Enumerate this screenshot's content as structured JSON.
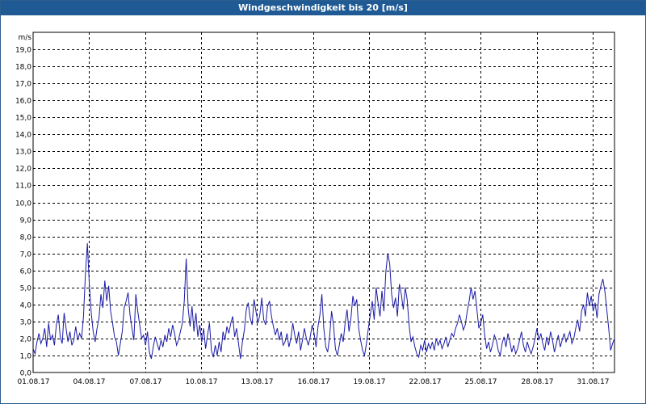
{
  "window": {
    "title": "Windgeschwindigkeit bis 20 [m/s]"
  },
  "colors": {
    "titlebar": "#1f5a94",
    "series": "#1a1aa6",
    "grid": "#000000"
  },
  "chart_data": {
    "type": "line",
    "title": "Windgeschwindigkeit bis 20 [m/s]",
    "ylabel": "m/s",
    "xlabel": "",
    "ylim": [
      0,
      20
    ],
    "ytick_step": 1,
    "grid": true,
    "xtick_labels": [
      "01.08.17",
      "04.08.17",
      "07.08.17",
      "10.08.17",
      "13.08.17",
      "16.08.17",
      "19.08.17",
      "22.08.17",
      "25.08.17",
      "28.08.17",
      "31.08.17"
    ],
    "series": [
      {
        "values": [
          1.4,
          1.1,
          1.8,
          2.3,
          1.7,
          2.0,
          2.6,
          1.5,
          2.9,
          1.9,
          2.2,
          1.6,
          2.8,
          3.4,
          2.1,
          1.7,
          3.5,
          2.6,
          1.8,
          2.4,
          1.6,
          1.9,
          2.7,
          1.9,
          2.3,
          2.0,
          3.3,
          5.8,
          7.6,
          5.2,
          3.5,
          2.4,
          1.8,
          2.6,
          3.2,
          4.6,
          3.8,
          5.4,
          4.2,
          5.1,
          3.6,
          2.9,
          2.1,
          1.8,
          1.0,
          1.7,
          2.4,
          3.8,
          4.2,
          4.7,
          3.4,
          2.6,
          1.9,
          4.6,
          3.6,
          2.8,
          2.0,
          2.2,
          1.6,
          2.4,
          1.2,
          0.8,
          1.5,
          2.1,
          1.7,
          1.3,
          1.9,
          1.5,
          2.2,
          1.8,
          2.6,
          2.1,
          2.8,
          2.3,
          1.6,
          1.9,
          2.4,
          2.9,
          4.2,
          6.7,
          3.8,
          2.7,
          3.9,
          2.4,
          3.5,
          2.1,
          2.8,
          1.8,
          2.6,
          1.4,
          2.2,
          2.9,
          1.3,
          0.9,
          1.6,
          1.0,
          1.8,
          1.2,
          2.4,
          1.9,
          2.7,
          2.3,
          2.9,
          3.3,
          2.1,
          2.6,
          1.7,
          0.8,
          1.8,
          2.5,
          3.7,
          4.1,
          3.2,
          2.8,
          4.3,
          3.6,
          2.9,
          3.4,
          4.4,
          3.1,
          2.8,
          3.9,
          4.2,
          3.3,
          2.7,
          2.2,
          2.6,
          1.9,
          2.4,
          1.6,
          1.8,
          2.3,
          1.5,
          2.0,
          2.9,
          2.2,
          1.7,
          2.4,
          1.3,
          1.9,
          2.6,
          2.0,
          1.6,
          2.1,
          2.8,
          2.3,
          1.5,
          2.7,
          3.4,
          4.6,
          2.6,
          1.5,
          1.2,
          2.1,
          3.6,
          2.8,
          1.4,
          1.0,
          1.6,
          2.3,
          1.8,
          2.9,
          3.7,
          2.4,
          3.2,
          4.5,
          3.9,
          4.3,
          2.6,
          1.9,
          1.3,
          1.0,
          1.7,
          2.6,
          3.4,
          4.2,
          3.1,
          5.0,
          4.1,
          3.3,
          4.8,
          3.6,
          5.9,
          7.0,
          6.4,
          4.6,
          3.8,
          4.4,
          3.3,
          5.2,
          4.6,
          3.7,
          5.0,
          4.3,
          2.8,
          1.8,
          2.1,
          1.5,
          1.1,
          0.9,
          1.6,
          1.3,
          1.9,
          1.2,
          1.7,
          1.4,
          1.8,
          1.3,
          2.0,
          1.6,
          1.9,
          1.4,
          1.7,
          2.1,
          1.5,
          1.9,
          2.3,
          2.1,
          2.6,
          2.9,
          3.4,
          3.0,
          2.5,
          2.8,
          3.6,
          4.2,
          5.0,
          4.3,
          4.8,
          3.7,
          2.6,
          2.9,
          3.4,
          2.2,
          1.4,
          1.8,
          1.2,
          1.6,
          2.2,
          1.9,
          1.3,
          1.0,
          1.7,
          2.1,
          1.5,
          2.3,
          1.8,
          1.2,
          1.6,
          1.1,
          1.4,
          1.9,
          2.4,
          1.6,
          1.2,
          1.8,
          1.4,
          1.1,
          1.5,
          2.0,
          2.6,
          1.9,
          2.3,
          1.7,
          1.3,
          2.1,
          1.6,
          2.4,
          1.9,
          1.2,
          1.7,
          2.2,
          1.5,
          1.9,
          2.3,
          1.8,
          2.1,
          2.4,
          1.7,
          2.0,
          2.6,
          3.1,
          2.4,
          3.6,
          4.0,
          3.3,
          4.7,
          3.9,
          4.5,
          3.6,
          4.1,
          3.2,
          4.6,
          5.1,
          5.5,
          4.8,
          3.7,
          2.6,
          1.3,
          1.7,
          2.0
        ]
      }
    ]
  }
}
